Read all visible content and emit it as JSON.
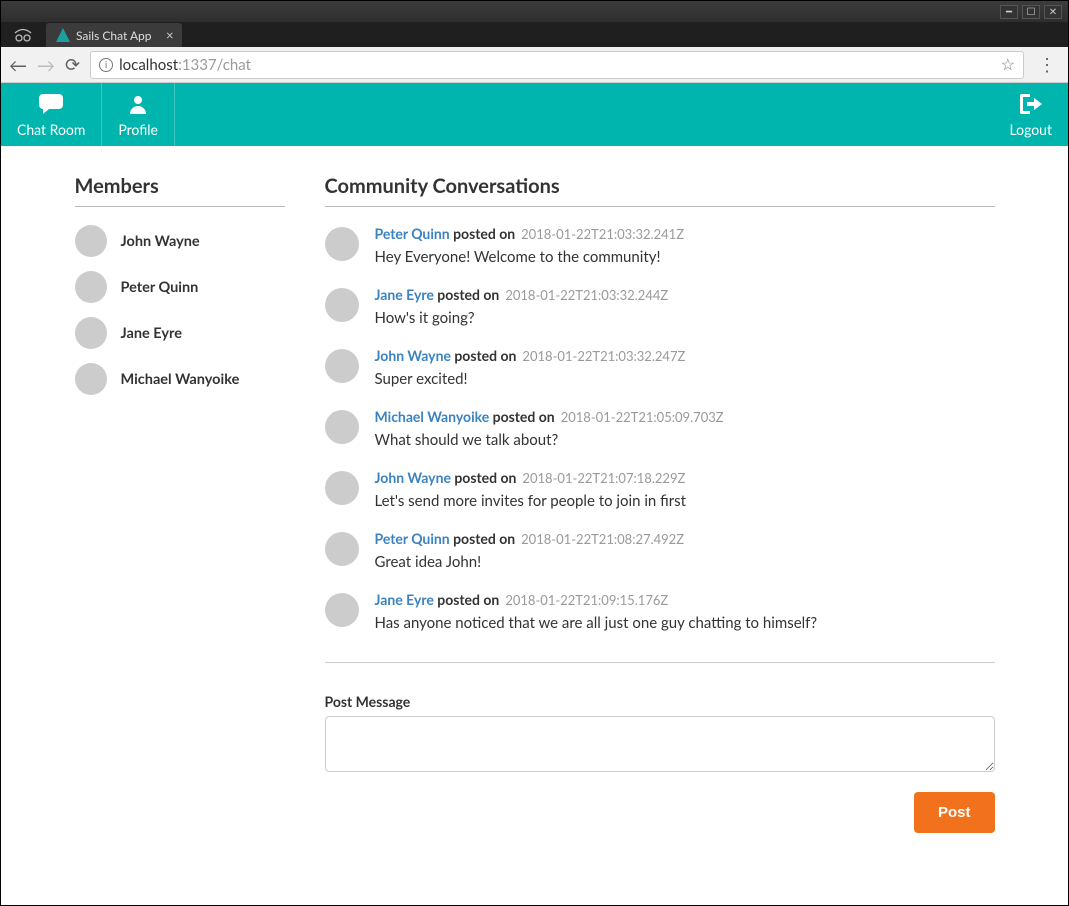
{
  "window": {
    "tab_title": "Sails Chat App",
    "url_host_dim1": "localhost",
    "url_host_dim2": ":1337",
    "url_path": "/chat"
  },
  "nav": {
    "chat_room": "Chat Room",
    "profile": "Profile",
    "logout": "Logout"
  },
  "sidebar": {
    "heading": "Members",
    "members": [
      {
        "name": "John Wayne",
        "avatar": "av1"
      },
      {
        "name": "Peter Quinn",
        "avatar": "av2"
      },
      {
        "name": "Jane Eyre",
        "avatar": "av3"
      },
      {
        "name": "Michael Wanyoike",
        "avatar": "av4"
      }
    ]
  },
  "main": {
    "heading": "Community Conversations",
    "posted_on": " posted on",
    "messages": [
      {
        "author": "Peter Quinn",
        "avatar": "av2",
        "time": "2018-01-22T21:03:32.241Z",
        "text": "Hey Everyone! Welcome to the community!"
      },
      {
        "author": "Jane Eyre",
        "avatar": "av3",
        "time": "2018-01-22T21:03:32.244Z",
        "text": "How's it going?"
      },
      {
        "author": "John Wayne",
        "avatar": "av1",
        "time": "2018-01-22T21:03:32.247Z",
        "text": "Super excited!"
      },
      {
        "author": "Michael Wanyoike",
        "avatar": "av4",
        "time": "2018-01-22T21:05:09.703Z",
        "text": "What should we talk about?"
      },
      {
        "author": "John Wayne",
        "avatar": "av1",
        "time": "2018-01-22T21:07:18.229Z",
        "text": "Let's send more invites for people to join in first"
      },
      {
        "author": "Peter Quinn",
        "avatar": "av2",
        "time": "2018-01-22T21:08:27.492Z",
        "text": "Great idea John!"
      },
      {
        "author": "Jane Eyre",
        "avatar": "av3",
        "time": "2018-01-22T21:09:15.176Z",
        "text": "Has anyone noticed that we are all just one guy chatting to himself?"
      }
    ]
  },
  "form": {
    "label": "Post Message",
    "button": "Post"
  }
}
